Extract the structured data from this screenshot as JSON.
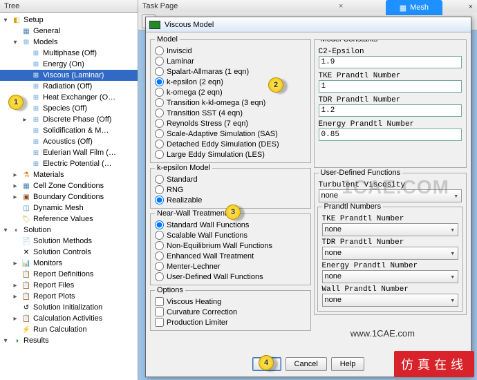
{
  "panels": {
    "tree": "Tree",
    "task": "Task Page",
    "mesh": "Mesh"
  },
  "tree": {
    "setup": "Setup",
    "general": "General",
    "models": "Models",
    "model_items": [
      "Multiphase (Off)",
      "Energy (On)",
      "Viscous (Laminar)",
      "Radiation (Off)",
      "Heat Exchanger (O…",
      "Species (Off)",
      "Discrete Phase (Off)",
      "Solidification & M…",
      "Acoustics (Off)",
      "Eulerian Wall Film (…",
      "Electric Potential (…"
    ],
    "materials": "Materials",
    "cell_zone": "Cell Zone Conditions",
    "boundary": "Boundary Conditions",
    "dynamic_mesh": "Dynamic Mesh",
    "reference": "Reference Values",
    "solution": "Solution",
    "sol_items": [
      "Solution Methods",
      "Solution Controls",
      "Monitors",
      "Report Definitions",
      "Report Files",
      "Report Plots",
      "Solution Initialization",
      "Calculation Activities",
      "Run Calculation"
    ],
    "results": "Results"
  },
  "dialog": {
    "title": "Viscous Model",
    "model_group": "Model",
    "models": [
      "Inviscid",
      "Laminar",
      "Spalart-Allmaras (1 eqn)",
      "k-epsilon (2 eqn)",
      "k-omega (2 eqn)",
      "Transition k-kl-omega (3 eqn)",
      "Transition SST (4 eqn)",
      "Reynolds Stress (7 eqn)",
      "Scale-Adaptive Simulation (SAS)",
      "Detached Eddy Simulation (DES)",
      "Large Eddy Simulation (LES)"
    ],
    "kemodel_group": "k-epsilon Model",
    "kemodels": [
      "Standard",
      "RNG",
      "Realizable"
    ],
    "nwt_group": "Near-Wall Treatment",
    "nwt": [
      "Standard Wall Functions",
      "Scalable Wall Functions",
      "Non-Equilibrium Wall Functions",
      "Enhanced Wall Treatment",
      "Menter-Lechner",
      "User-Defined Wall Functions"
    ],
    "options_group": "Options",
    "options": [
      "Viscous Heating",
      "Curvature Correction",
      "Production Limiter"
    ],
    "constants_group": "Model Constants",
    "constants": [
      {
        "label": "C2-Epsilon",
        "value": "1.9"
      },
      {
        "label": "TKE Prandtl Number",
        "value": "1"
      },
      {
        "label": "TDR Prandtl Number",
        "value": "1.2"
      },
      {
        "label": "Energy Prandtl Number",
        "value": "0.85"
      }
    ],
    "udf_group": "User-Defined Functions",
    "udf_tv_label": "Turbulent Viscosity",
    "udf_tv_value": "none",
    "prandtl_group": "Prandtl Numbers",
    "prandtl": [
      {
        "label": "TKE Prandtl Number",
        "value": "none"
      },
      {
        "label": "TDR Prandtl Number",
        "value": "none"
      },
      {
        "label": "Energy Prandtl Number",
        "value": "none"
      },
      {
        "label": "Wall Prandtl Number",
        "value": "none"
      }
    ],
    "buttons": {
      "ok": "OK",
      "cancel": "Cancel",
      "help": "Help"
    }
  },
  "callouts": {
    "c1": "1",
    "c2": "2",
    "c3": "3",
    "c4": "4"
  },
  "watermark": "1CAE.COM",
  "url": "www.1CAE.com",
  "sticker": "仿真在线"
}
